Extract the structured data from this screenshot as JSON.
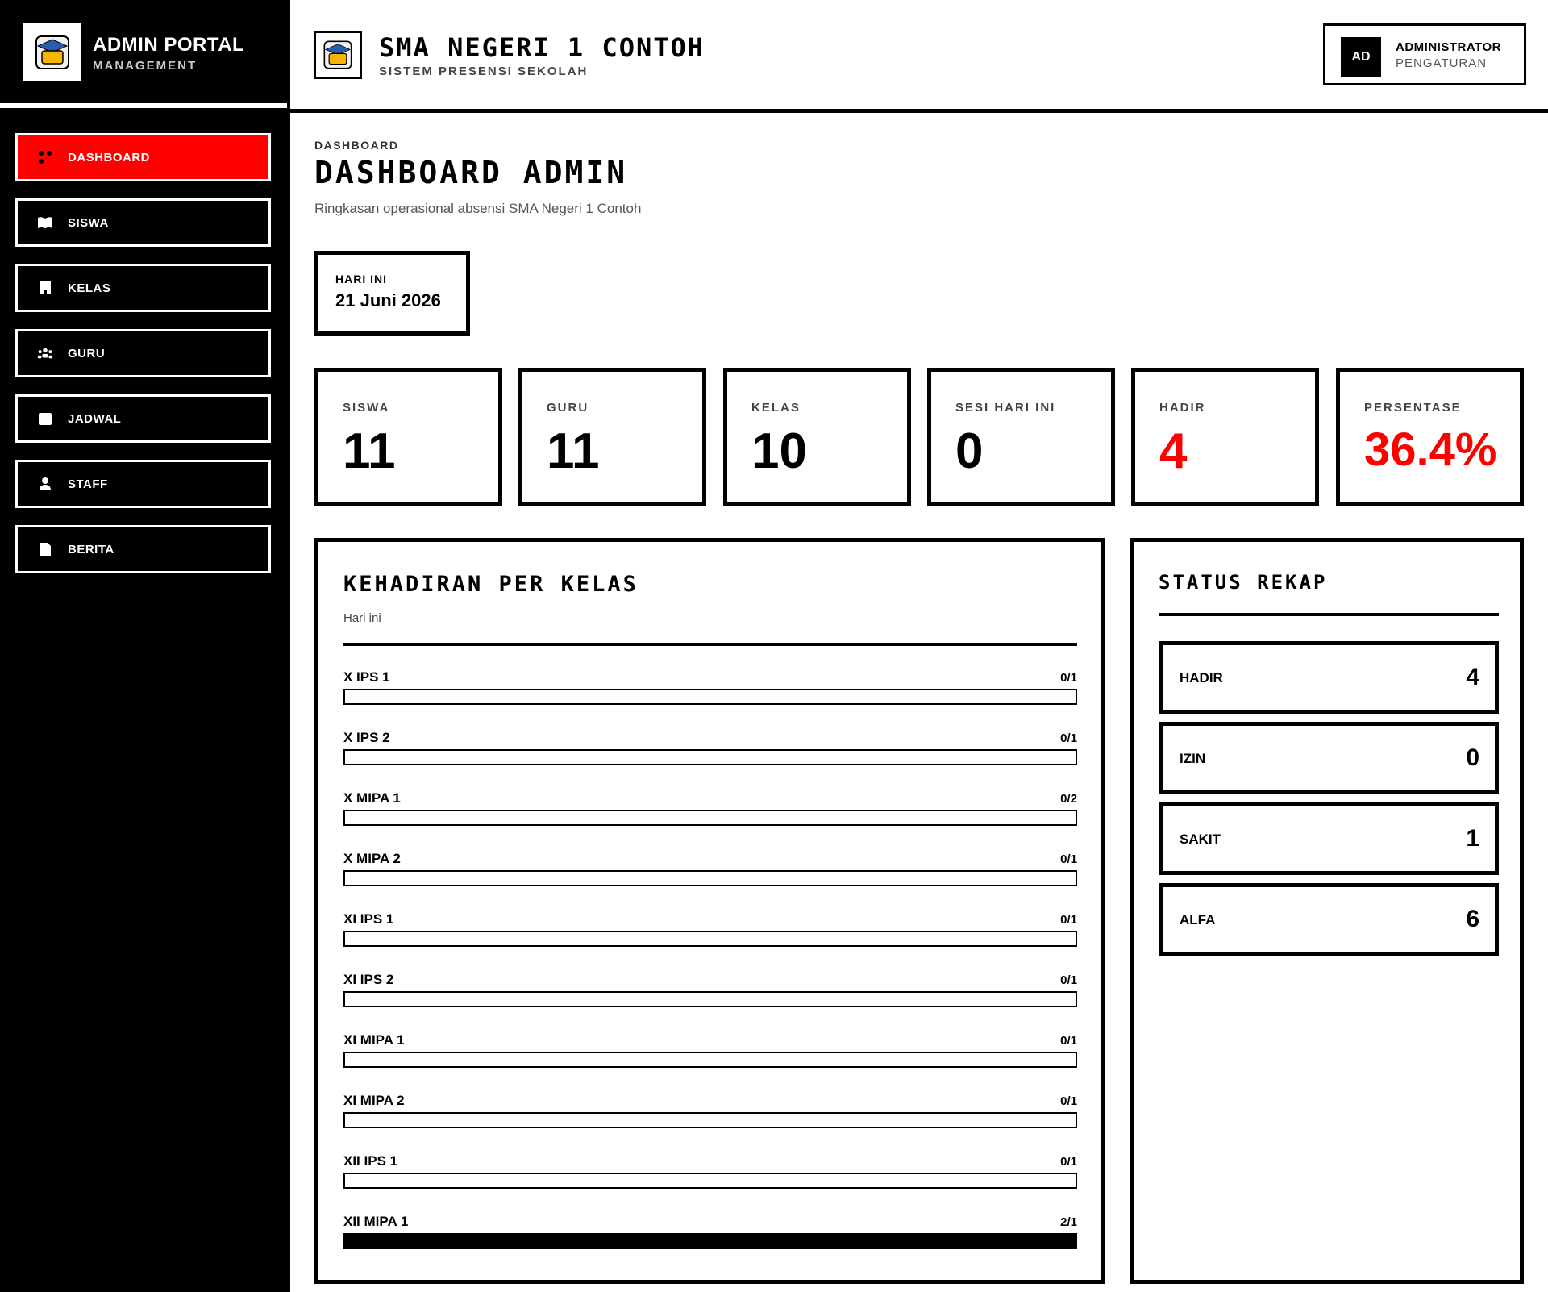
{
  "brand": {
    "title": "ADMIN PORTAL",
    "subtitle": "MANAGEMENT",
    "logo_text": "SMA"
  },
  "nav": [
    {
      "label": "DASHBOARD",
      "icon": "dashboard-icon",
      "active": true
    },
    {
      "label": "SISWA",
      "icon": "book-icon"
    },
    {
      "label": "KELAS",
      "icon": "building-icon"
    },
    {
      "label": "GURU",
      "icon": "group-icon"
    },
    {
      "label": "JADWAL",
      "icon": "calendar-icon"
    },
    {
      "label": "STAFF",
      "icon": "person-icon"
    },
    {
      "label": "BERITA",
      "icon": "document-icon"
    }
  ],
  "header": {
    "school_name": "SMA NEGERI 1 CONTOH",
    "school_sub": "SISTEM PRESENSI SEKOLAH",
    "user": {
      "initials": "AD",
      "name": "ADMINISTRATOR",
      "sub": "PENGATURAN"
    }
  },
  "page": {
    "breadcrumb": "DASHBOARD",
    "title": "DASHBOARD ADMIN",
    "subtitle": "Ringkasan operasional absensi SMA Negeri 1 Contoh"
  },
  "today": {
    "label": "HARI INI",
    "date": "21 Juni 2026"
  },
  "stats": [
    {
      "label": "SISWA",
      "value": "11",
      "accent": false
    },
    {
      "label": "GURU",
      "value": "11",
      "accent": false
    },
    {
      "label": "KELAS",
      "value": "10",
      "accent": false
    },
    {
      "label": "SESI HARI INI",
      "value": "0",
      "accent": false
    },
    {
      "label": "HADIR",
      "value": "4",
      "accent": true
    },
    {
      "label": "PERSENTASE",
      "value": "36.4%",
      "accent": true
    }
  ],
  "kehadiran": {
    "title": "KEHADIRAN PER KELAS",
    "subtitle": "Hari ini",
    "classes": [
      {
        "name": "X IPS 1",
        "count": "0/1",
        "fill": 0
      },
      {
        "name": "X IPS 2",
        "count": "0/1",
        "fill": 0
      },
      {
        "name": "X MIPA 1",
        "count": "0/2",
        "fill": 0
      },
      {
        "name": "X MIPA 2",
        "count": "0/1",
        "fill": 0
      },
      {
        "name": "XI IPS 1",
        "count": "0/1",
        "fill": 0
      },
      {
        "name": "XI IPS 2",
        "count": "0/1",
        "fill": 0
      },
      {
        "name": "XI MIPA 1",
        "count": "0/1",
        "fill": 0
      },
      {
        "name": "XI MIPA 2",
        "count": "0/1",
        "fill": 0
      },
      {
        "name": "XII IPS 1",
        "count": "0/1",
        "fill": 0
      },
      {
        "name": "XII MIPA 1",
        "count": "2/1",
        "fill": 1
      }
    ]
  },
  "rekap": {
    "title": "STATUS REKAP",
    "items": [
      {
        "label": "HADIR",
        "value": "4"
      },
      {
        "label": "IZIN",
        "value": "0"
      },
      {
        "label": "SAKIT",
        "value": "1"
      },
      {
        "label": "ALFA",
        "value": "6"
      }
    ]
  },
  "colors": {
    "accent": "#ff0000",
    "sidebar_bg": "#000000",
    "surface": "#ffffff"
  }
}
